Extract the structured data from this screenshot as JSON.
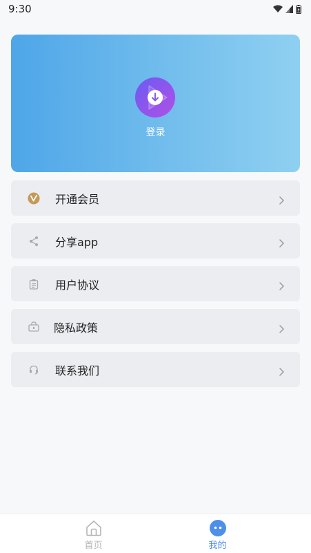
{
  "status_bar": {
    "time": "9:30",
    "icons": [
      "wifi-icon",
      "signal-icon",
      "battery-icon"
    ]
  },
  "header": {
    "login_label": "登录",
    "logo_icon": "download-play-logo-icon",
    "gradient_start": "#4ea6e8",
    "gradient_end": "#8fd0f1"
  },
  "menu": {
    "items": [
      {
        "label": "开通会员",
        "icon": "vip-badge-icon"
      },
      {
        "label": "分享app",
        "icon": "share-icon"
      },
      {
        "label": "用户协议",
        "icon": "clipboard-icon"
      },
      {
        "label": "隐私政策",
        "icon": "lock-briefcase-icon"
      },
      {
        "label": "联系我们",
        "icon": "headset-icon"
      }
    ]
  },
  "bottom_nav": {
    "items": [
      {
        "label": "首页",
        "icon": "home-icon",
        "active": false
      },
      {
        "label": "我的",
        "icon": "profile-face-icon",
        "active": true
      }
    ],
    "active_color": "#4e8fe8",
    "inactive_color": "#b5b5b5"
  }
}
